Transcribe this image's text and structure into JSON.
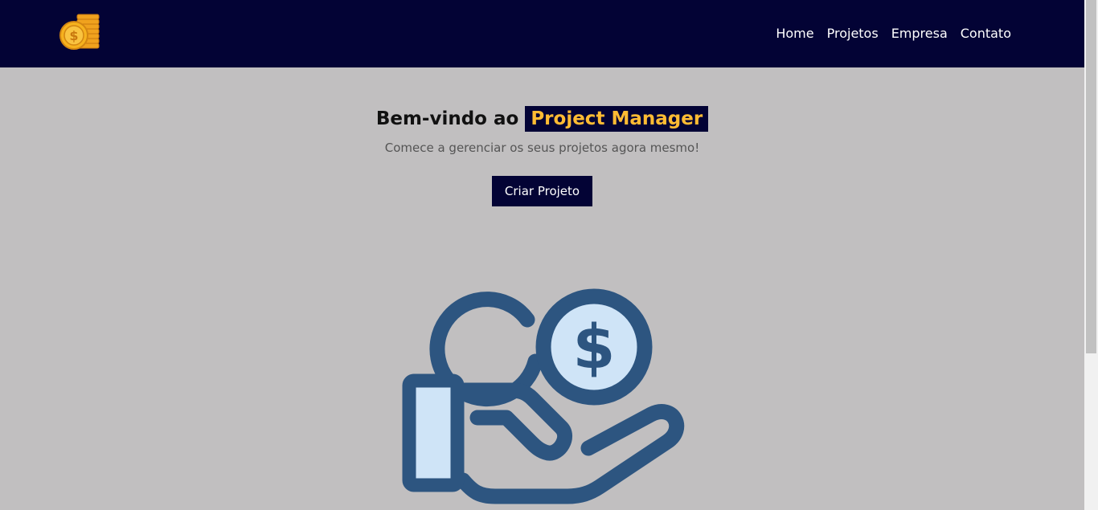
{
  "header": {
    "logo_icon": "coin-stack-icon",
    "nav": [
      {
        "label": "Home"
      },
      {
        "label": "Projetos"
      },
      {
        "label": "Empresa"
      },
      {
        "label": "Contato"
      }
    ]
  },
  "hero": {
    "title_prefix": "Bem-vindo ao",
    "title_highlight": "Project Manager",
    "subtitle": "Comece a gerenciar os seus projetos agora mesmo!",
    "cta_label": "Criar Projeto",
    "illustration_icon": "hand-holding-coins-icon"
  },
  "colors": {
    "navbar_bg": "#030335",
    "page_bg": "#c1bfc0",
    "accent": "#ffbb33",
    "illustration_stroke": "#2d5580",
    "illustration_fill": "#cfe4f7"
  }
}
